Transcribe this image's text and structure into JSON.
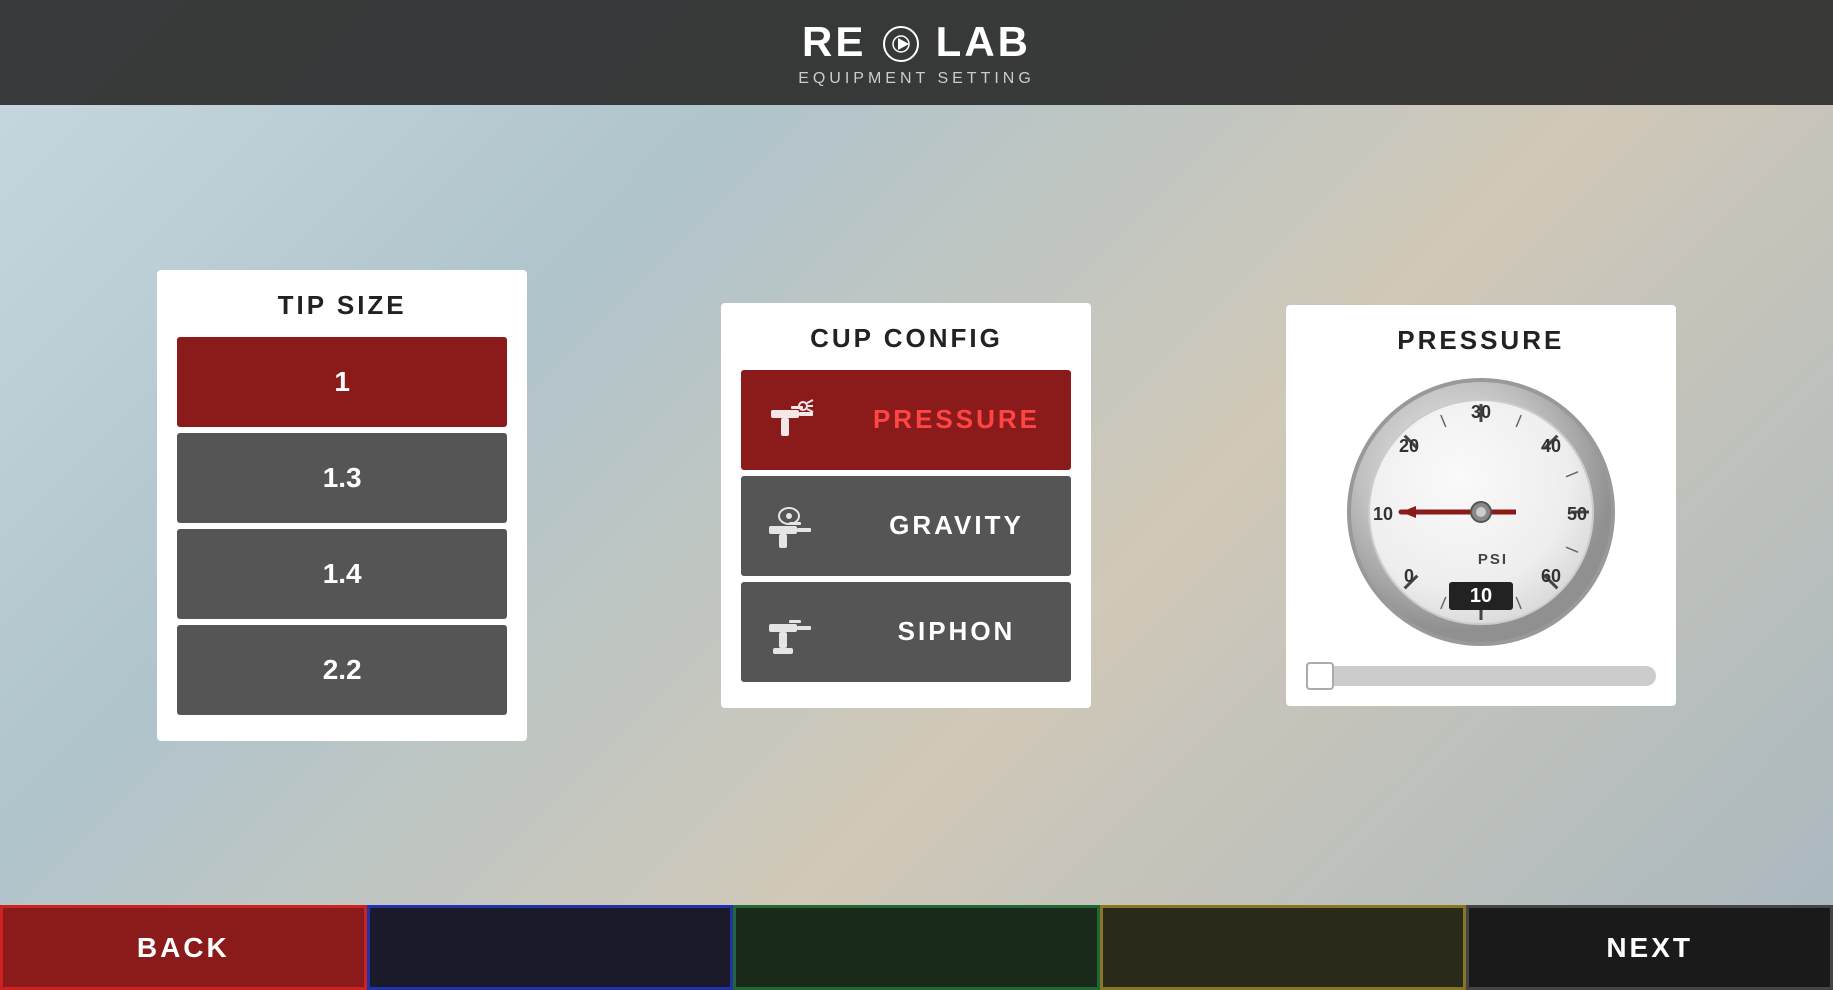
{
  "header": {
    "logo": "RE▷LAB",
    "logo_left": "RE",
    "logo_play": "▷",
    "logo_right": "LAB",
    "subtitle": "EQUIPMENT SETTING"
  },
  "tip_size": {
    "title": "TIP SIZE",
    "options": [
      {
        "value": "1",
        "active": true
      },
      {
        "value": "1.3",
        "active": false
      },
      {
        "value": "1.4",
        "active": false
      },
      {
        "value": "2.2",
        "active": false
      }
    ]
  },
  "cup_config": {
    "title": "CUP CONFIG",
    "options": [
      {
        "label": "PRESSURE",
        "active": true
      },
      {
        "label": "GRAVITY",
        "active": false
      },
      {
        "label": "SIPHON",
        "active": false
      }
    ]
  },
  "pressure": {
    "title": "PRESSURE",
    "unit": "PSI",
    "value": "10",
    "gauge_labels": [
      "0",
      "10",
      "20",
      "30",
      "40",
      "50",
      "60"
    ],
    "min": 0,
    "max": 60,
    "current": 10
  },
  "bottom_bar": {
    "back_label": "BACK",
    "next_label": "NEXT",
    "slot1_label": "",
    "slot2_label": "",
    "slot3_label": ""
  }
}
